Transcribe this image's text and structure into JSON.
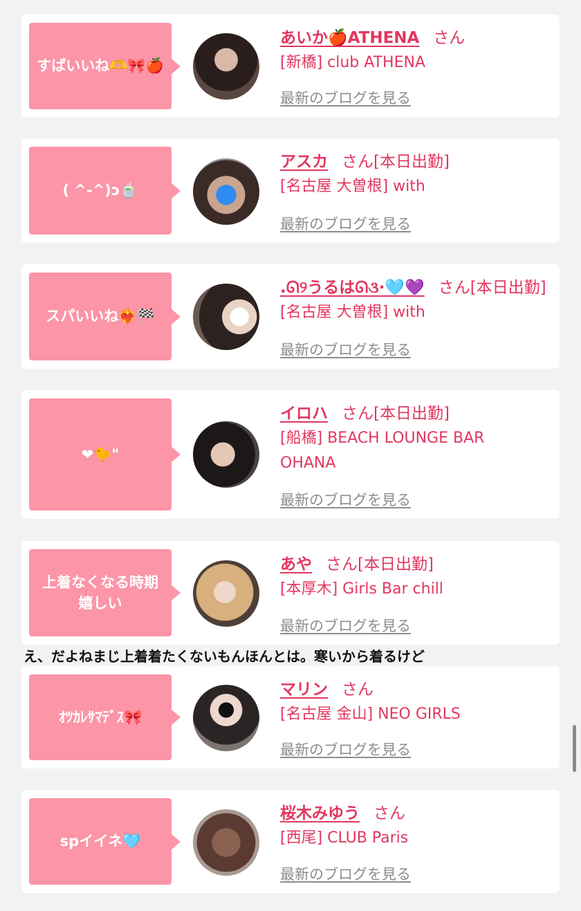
{
  "cards": [
    {
      "comment": "すぱいいね🫶🎀🍎",
      "name": "あいか🍎ATHENA",
      "san": "さん",
      "status": "",
      "shop": "[新橋] club ATHENA",
      "blog_link": "最新のブログを見る"
    },
    {
      "comment": "( ^-^)ɔ🍵",
      "name": "アスカ",
      "san": "さん",
      "status": "[本日出勤]",
      "shop": "[名古屋 大曽根] with",
      "blog_link": "最新のブログを見る"
    },
    {
      "comment": "スパいいね❤️‍🔥🏁",
      "name": ".ᘏ୨うるはᘏ૩·🩵💜",
      "san": "さん",
      "status": "[本日出勤]",
      "shop": "[名古屋 大曽根] with",
      "blog_link": "最新のブログを見る"
    },
    {
      "comment": "❤🐤\"",
      "name": "イロハ",
      "san": "さん",
      "status": "[本日出勤]",
      "shop": "[船橋] BEACH LOUNGE BAR OHANA",
      "blog_link": "最新のブログを見る"
    },
    {
      "comment": "上着なくなる時期嬉しい",
      "name": "あや",
      "san": "さん",
      "status": "[本日出勤]",
      "shop": "[本厚木] Girls Bar chill",
      "blog_link": "最新のブログを見る"
    },
    {
      "comment": "ｵﾂｶﾚｻﾏﾃﾞｽ🎀",
      "name": "マリン",
      "san": "さん",
      "status": "",
      "shop": "[名古屋 金山] NEO GIRLS",
      "blog_link": "最新のブログを見る"
    },
    {
      "comment": "spイイネ🩵",
      "name": "桜木みゆう",
      "san": "さん",
      "status": "",
      "shop": "[西尾] CLUB Paris",
      "blog_link": "最新のブログを見る"
    }
  ],
  "reply_text": "え、だよねまじ上着着たくないもんほんとは。寒いから着るけど",
  "colors": {
    "accent": "#e2375f",
    "bubble": "#fb95a7",
    "link_gray": "#8d8d8d",
    "background": "#f2f2f3"
  }
}
